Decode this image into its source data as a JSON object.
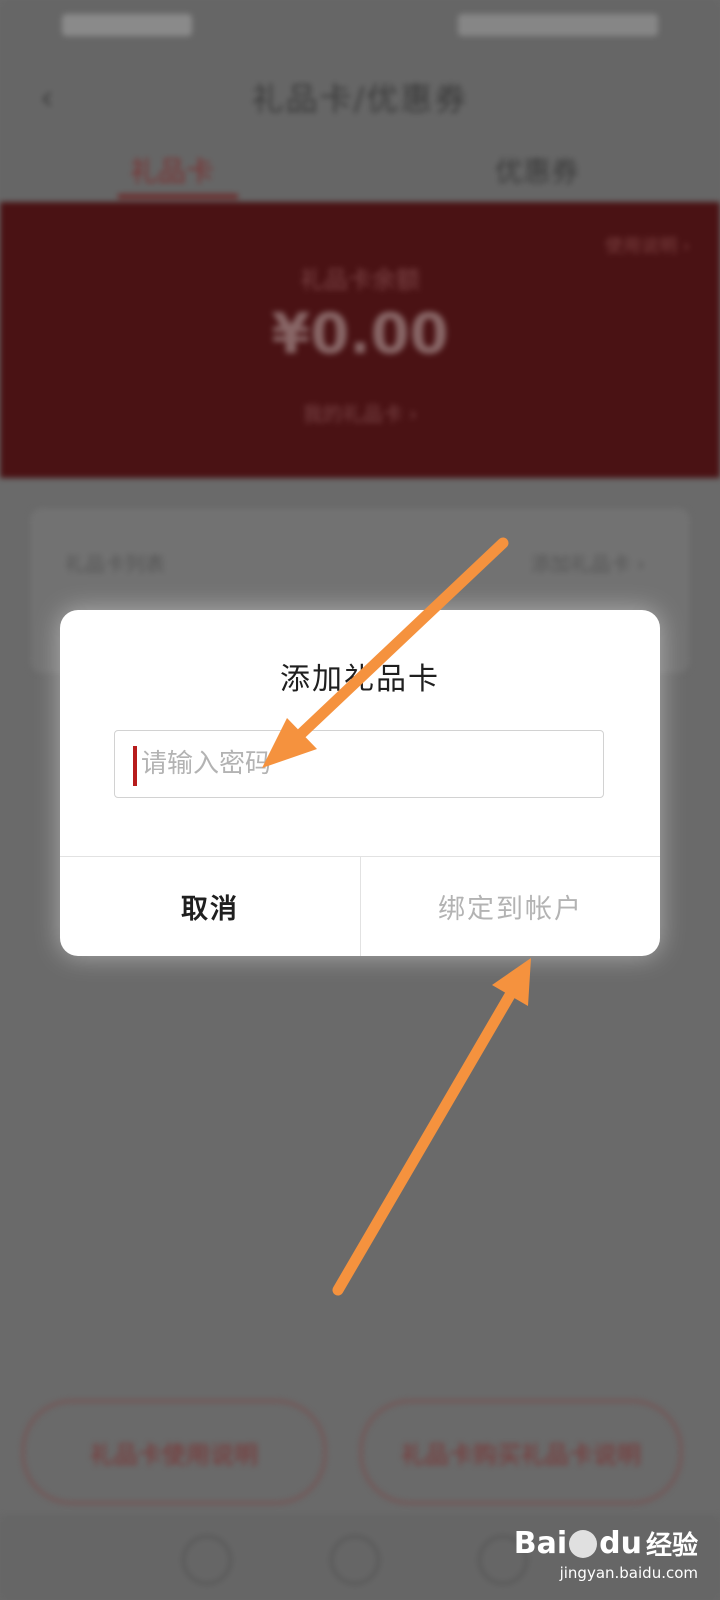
{
  "background_app": {
    "nav_title": "礼品卡/优惠券",
    "tabs": [
      {
        "label": "礼品卡"
      },
      {
        "label": "优惠券"
      }
    ],
    "banner": {
      "link": "使用说明 ›",
      "caption": "礼品卡余额",
      "amount": "¥0.00",
      "sub": "我的礼品卡 ›"
    },
    "card": {
      "left": "礼品卡列表",
      "right": "添加礼品卡 ›"
    },
    "bottom_actions": [
      {
        "label": "礼品卡使用说明"
      },
      {
        "label": "礼品卡购买礼品卡说明"
      }
    ]
  },
  "dialog": {
    "title": "添加礼品卡",
    "input": {
      "value": "",
      "placeholder": "请输入密码"
    },
    "cancel_label": "取消",
    "bind_label": "绑定到帐户"
  },
  "annotations": {
    "arrow_color": "#F5923E"
  },
  "watermark": {
    "brand": "Bai",
    "brand_suffix": "du",
    "product": "经验",
    "url": "jingyan.baidu.com"
  }
}
